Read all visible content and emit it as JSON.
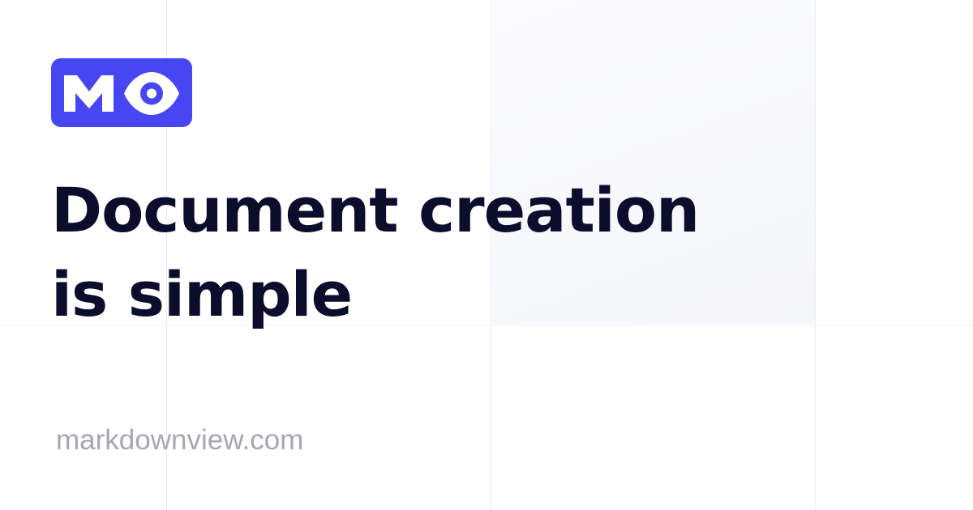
{
  "logo": {
    "icon": "mo-eye-logo",
    "background_color": "#4646f2",
    "foreground_color": "#ffffff"
  },
  "headline": {
    "line1": "Document creation",
    "line2": "is simple"
  },
  "site": {
    "domain": "markdownview.com"
  },
  "colors": {
    "headline": "#0c0c2c",
    "domain": "#a6a6b5",
    "grid_line": "#ededf2"
  }
}
